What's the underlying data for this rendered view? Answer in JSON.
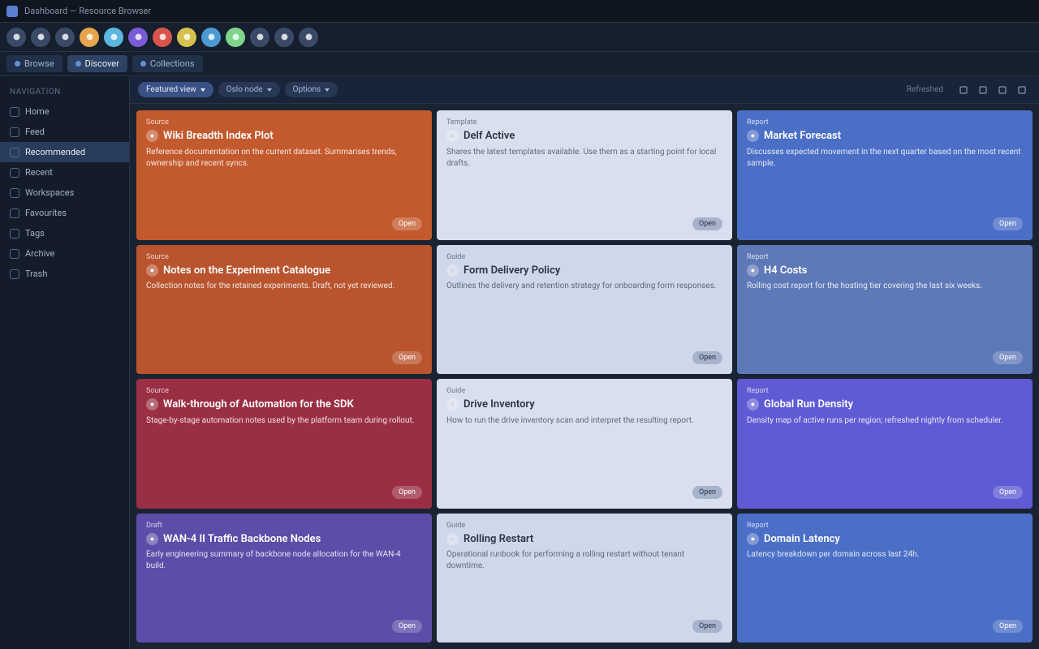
{
  "window": {
    "title": "Dashboard — Resource Browser"
  },
  "toolbar_icons": [
    {
      "name": "menu-icon",
      "bg": "#3a4a66"
    },
    {
      "name": "back-icon",
      "bg": "#3a4a66"
    },
    {
      "name": "forward-icon",
      "bg": "#3a4a66"
    },
    {
      "name": "avatar-icon",
      "bg": "#e7a44c"
    },
    {
      "name": "globe-icon",
      "bg": "#5bb7e0"
    },
    {
      "name": "plugin-icon",
      "bg": "#7b5bd4"
    },
    {
      "name": "record-icon",
      "bg": "#d9554c"
    },
    {
      "name": "star-icon",
      "bg": "#d4c24c"
    },
    {
      "name": "sync-icon",
      "bg": "#4c9ad4"
    },
    {
      "name": "tag-icon",
      "bg": "#7fd48c"
    },
    {
      "name": "grid-icon",
      "bg": "#3a4a66"
    },
    {
      "name": "settings-icon",
      "bg": "#3a4a66"
    },
    {
      "name": "help-icon",
      "bg": "#3a4a66"
    }
  ],
  "tabs": [
    {
      "label": "Browse",
      "icon": "folder-icon",
      "active": false
    },
    {
      "label": "Discover",
      "icon": "compass-icon",
      "active": true
    },
    {
      "label": "Collections",
      "icon": "stack-icon",
      "active": false
    }
  ],
  "sidebar": {
    "heading": "Navigation",
    "items": [
      {
        "label": "Home",
        "icon": "home-icon",
        "selected": false
      },
      {
        "label": "Feed",
        "icon": "feed-icon",
        "selected": false
      },
      {
        "label": "Recommended",
        "icon": "spark-icon",
        "selected": true
      },
      {
        "label": "Recent",
        "icon": "clock-icon",
        "selected": false
      },
      {
        "label": "Workspaces",
        "icon": "layers-icon",
        "selected": false
      },
      {
        "label": "Favourites",
        "icon": "heart-icon",
        "selected": false
      },
      {
        "label": "Tags",
        "icon": "tag-icon",
        "selected": false
      },
      {
        "label": "Archive",
        "icon": "archive-icon",
        "selected": false
      },
      {
        "label": "Trash",
        "icon": "trash-icon",
        "selected": false
      }
    ]
  },
  "filters": {
    "pills": [
      {
        "label": "Featured view",
        "primary": true
      },
      {
        "label": "Oslo node",
        "primary": false
      },
      {
        "label": "Options",
        "primary": false
      }
    ],
    "status_label": "Refreshed",
    "actions": [
      "grid-view-icon",
      "list-view-icon",
      "sort-icon",
      "more-icon"
    ]
  },
  "grid_action_label": "Open",
  "cards": [
    {
      "tag": "Source",
      "title": "Wiki Breadth Index Plot",
      "desc": "Reference documentation on the current dataset. Summarises trends, ownership and recent syncs.",
      "theme": "c-orange",
      "light": false
    },
    {
      "tag": "Template",
      "title": "Delf Active",
      "desc": "Shares the latest templates available. Use them as a starting point for local drafts.",
      "theme": "c-light",
      "light": true
    },
    {
      "tag": "Report",
      "title": "Market Forecast",
      "desc": "Discusses expected movement in the next quarter based on the most recent sample.",
      "theme": "c-blue",
      "light": false
    },
    {
      "tag": "Source",
      "title": "Notes on the Experiment Catalogue",
      "desc": "Collection notes for the retained experiments. Draft, not yet reviewed.",
      "theme": "c-orange2",
      "light": false
    },
    {
      "tag": "Guide",
      "title": "Form Delivery Policy",
      "desc": "Outlines the delivery and retention strategy for onboarding form responses.",
      "theme": "c-light2",
      "light": true
    },
    {
      "tag": "Report",
      "title": "H4 Costs",
      "desc": "Rolling cost report for the hosting tier covering the last six weeks.",
      "theme": "c-slate",
      "light": false
    },
    {
      "tag": "Source",
      "title": "Walk-through of Automation for the SDK",
      "desc": "Stage-by-stage automation notes used by the platform team during rollout.",
      "theme": "c-crimson",
      "light": false
    },
    {
      "tag": "Guide",
      "title": "Drive Inventory",
      "desc": "How to run the drive inventory scan and interpret the resulting report.",
      "theme": "c-light",
      "light": true
    },
    {
      "tag": "Report",
      "title": "Global Run Density",
      "desc": "Density map of active runs per region; refreshed nightly from scheduler.",
      "theme": "c-indigo",
      "light": false
    },
    {
      "tag": "Draft",
      "title": "WAN-4 II Traffic Backbone Nodes",
      "desc": "Early engineering summary of backbone node allocation for the WAN-4 build.",
      "theme": "c-violet",
      "light": false
    },
    {
      "tag": "Guide",
      "title": "Rolling Restart",
      "desc": "Operational runbook for performing a rolling restart without tenant downtime.",
      "theme": "c-light2",
      "light": true
    },
    {
      "tag": "Report",
      "title": "Domain Latency",
      "desc": "Latency breakdown per domain across last 24h.",
      "theme": "c-blue",
      "light": false
    }
  ]
}
